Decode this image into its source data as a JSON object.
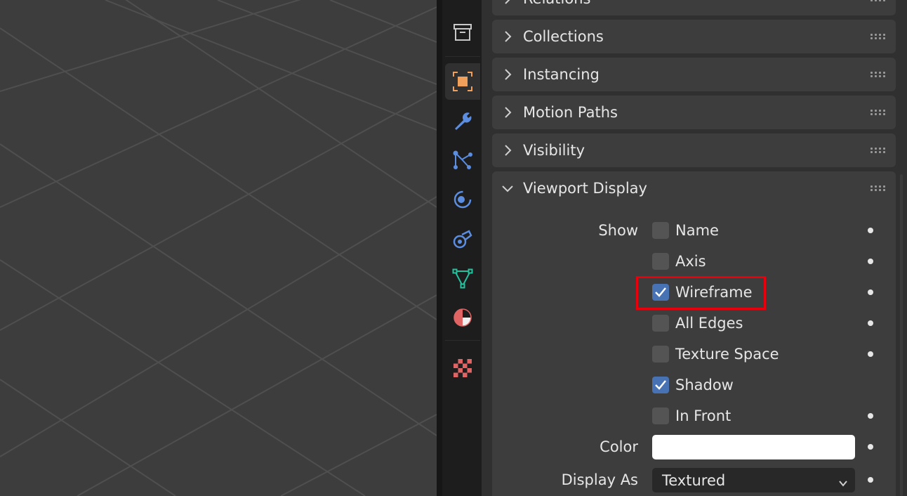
{
  "panels": {
    "relations": {
      "title": "Relations"
    },
    "collections": {
      "title": "Collections"
    },
    "instancing": {
      "title": "Instancing"
    },
    "motion_paths": {
      "title": "Motion Paths"
    },
    "visibility": {
      "title": "Visibility"
    },
    "viewport_display": {
      "title": "Viewport Display",
      "show_label": "Show",
      "options": [
        {
          "label": "Name",
          "checked": false
        },
        {
          "label": "Axis",
          "checked": false
        },
        {
          "label": "Wireframe",
          "checked": true
        },
        {
          "label": "All Edges",
          "checked": false
        },
        {
          "label": "Texture Space",
          "checked": false
        },
        {
          "label": "Shadow",
          "checked": true
        },
        {
          "label": "In Front",
          "checked": false
        }
      ],
      "color_label": "Color",
      "color_value": "#ffffff",
      "display_as_label": "Display As",
      "display_as_value": "Textured"
    }
  },
  "tabs": [
    "collection-icon",
    "object-icon",
    "modifier-wrench-icon",
    "particles-icon",
    "physics-icon",
    "constraints-icon",
    "object-data-mesh-icon",
    "material-icon",
    "texture-icon"
  ],
  "colors": {
    "checkbox_checked": "#4772b3",
    "highlight": "#e8000d",
    "object_tab": "#f0a05a",
    "mesh_tab": "#23c3a0",
    "material_tab": "#e06464"
  }
}
